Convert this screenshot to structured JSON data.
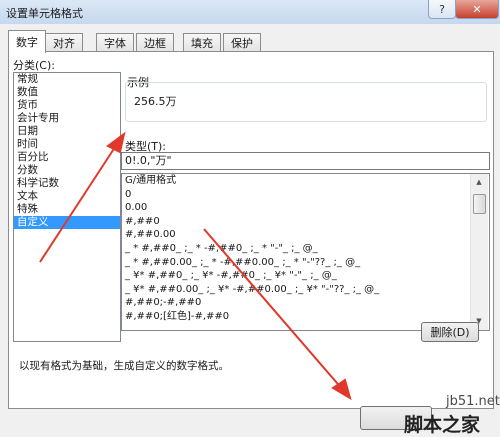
{
  "window": {
    "title": "设置单元格格式",
    "help_label": "?",
    "close_label": "✕"
  },
  "tabs": [
    {
      "label": "数字",
      "active": true
    },
    {
      "label": "对齐",
      "active": false
    },
    {
      "label": "字体",
      "active": false
    },
    {
      "label": "边框",
      "active": false
    },
    {
      "label": "填充",
      "active": false
    },
    {
      "label": "保护",
      "active": false
    }
  ],
  "category": {
    "label": "分类(C):",
    "items": [
      "常规",
      "数值",
      "货币",
      "会计专用",
      "日期",
      "时间",
      "百分比",
      "分数",
      "科学记数",
      "文本",
      "特殊",
      "自定义"
    ],
    "selected": "自定义"
  },
  "sample": {
    "label": "示例",
    "value": "256.5万"
  },
  "type": {
    "label": "类型(T):",
    "value": "0!.0,\"万\"",
    "formats": [
      "G/通用格式",
      "0",
      "0.00",
      "#,##0",
      "#,##0.00",
      "_ * #,##0_ ;_ * -#,##0_ ;_ * \"-\"_ ;_ @_",
      "_ * #,##0.00_ ;_ * -#,##0.00_ ;_ * \"-\"??_ ;_ @_",
      "_ ¥* #,##0_ ;_ ¥* -#,##0_ ;_ ¥* \"-\"_ ;_ @_",
      "_ ¥* #,##0.00_ ;_ ¥* -#,##0.00_ ;_ ¥* \"-\"??_ ;_ @_",
      "#,##0;-#,##0",
      "#,##0;[红色]-#,##0"
    ]
  },
  "delete_button": "删除(D)",
  "description": "以现有格式为基础，生成自定义的数字格式。",
  "watermark": {
    "site": "jb51.net",
    "name": "脚本之家"
  },
  "colors": {
    "selection": "#3399ff",
    "arrow": "#e0392b"
  }
}
